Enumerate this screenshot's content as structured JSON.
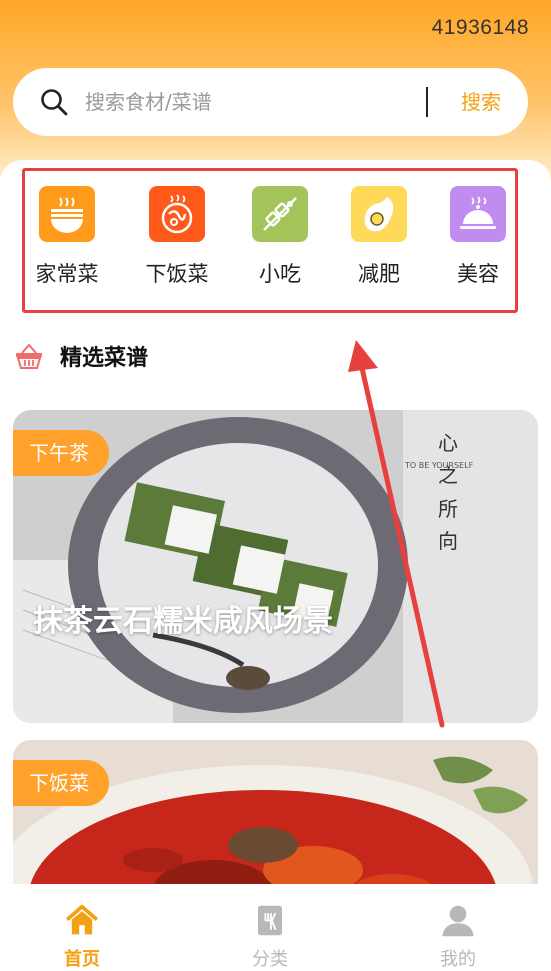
{
  "status": {
    "id_text": "41936148"
  },
  "search": {
    "placeholder": "搜索食材/菜谱",
    "button_label": "搜索"
  },
  "categories": [
    {
      "label": "家常菜",
      "icon": "noodle-bowl-icon",
      "color": "#ff9a1a"
    },
    {
      "label": "下饭菜",
      "icon": "spicy-dish-icon",
      "color": "#ff5a1a"
    },
    {
      "label": "小吃",
      "icon": "skewer-icon",
      "color": "#a4c45a"
    },
    {
      "label": "减肥",
      "icon": "avocado-icon",
      "color": "#ffd95a"
    },
    {
      "label": "美容",
      "icon": "cloche-icon",
      "color": "#c08cf0"
    }
  ],
  "section": {
    "title": "精选菜谱",
    "icon": "basket-icon"
  },
  "recipes": [
    {
      "tag": "下午茶",
      "title": "抹茶云石糯米咸风场景",
      "overlay_text": {
        "line1": "心",
        "line2": "之",
        "line3": "所",
        "line4": "向",
        "caption": "TO BE YOURSELF"
      }
    },
    {
      "tag": "下饭菜",
      "title": ""
    }
  ],
  "tabbar": {
    "items": [
      {
        "label": "首页",
        "icon": "home-icon",
        "active": true
      },
      {
        "label": "分类",
        "icon": "category-icon",
        "active": false
      },
      {
        "label": "我的",
        "icon": "profile-icon",
        "active": false
      }
    ],
    "active_color": "#f5a012",
    "inactive_color": "#b8b8b8"
  },
  "colors": {
    "accent": "#f5a012",
    "highlight_border": "#e8403f"
  }
}
